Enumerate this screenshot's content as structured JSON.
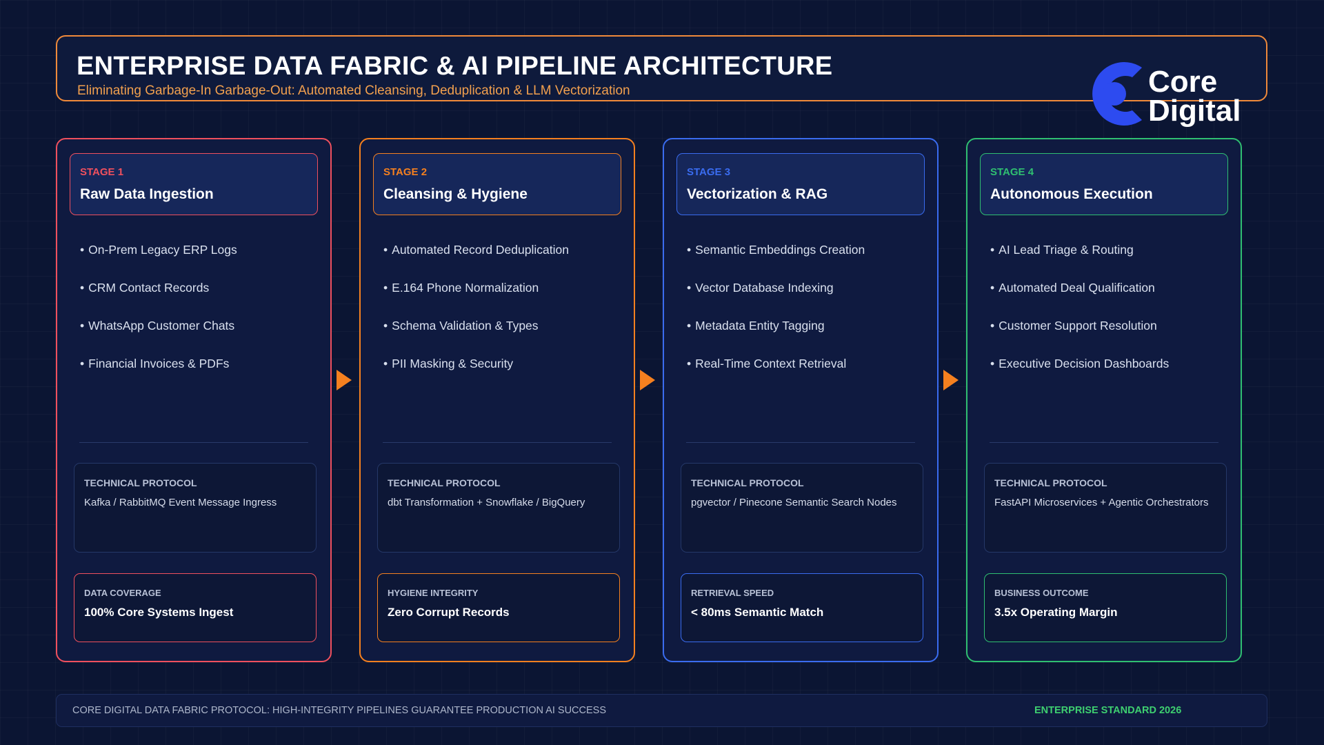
{
  "header": {
    "title": "ENTERPRISE DATA FABRIC & AI PIPELINE ARCHITECTURE",
    "subtitle": "Eliminating Garbage-In Garbage-Out: Automated Cleansing, Deduplication & LLM Vectorization"
  },
  "logo": {
    "word1": "Core",
    "word2": "Digital",
    "icon": "core-digital-logo-icon",
    "color": "#2d4bf0"
  },
  "colors": {
    "stage1": "#f0505e",
    "stage2": "#f5801f",
    "stage3": "#3a6cf0",
    "stage4": "#2fbf71",
    "arrow": "#f5801f"
  },
  "stages": [
    {
      "num": "STAGE 1",
      "title": "Raw Data Ingestion",
      "bullets": [
        "On-Prem Legacy ERP Logs",
        "CRM Contact Records",
        "WhatsApp Customer Chats",
        "Financial Invoices & PDFs"
      ],
      "protocol_label": "TECHNICAL PROTOCOL",
      "protocol": "Kafka / RabbitMQ Event Message Ingress",
      "metric_label": "DATA COVERAGE",
      "metric_value": "100% Core Systems Ingest"
    },
    {
      "num": "STAGE 2",
      "title": "Cleansing & Hygiene",
      "bullets": [
        "Automated Record Deduplication",
        "E.164 Phone Normalization",
        "Schema Validation & Types",
        "PII Masking & Security"
      ],
      "protocol_label": "TECHNICAL PROTOCOL",
      "protocol": "dbt Transformation + Snowflake / BigQuery",
      "metric_label": "HYGIENE INTEGRITY",
      "metric_value": "Zero Corrupt Records"
    },
    {
      "num": "STAGE 3",
      "title": "Vectorization & RAG",
      "bullets": [
        "Semantic Embeddings Creation",
        "Vector Database Indexing",
        "Metadata Entity Tagging",
        "Real-Time Context Retrieval"
      ],
      "protocol_label": "TECHNICAL PROTOCOL",
      "protocol": "pgvector / Pinecone Semantic Search Nodes",
      "metric_label": "RETRIEVAL SPEED",
      "metric_value": "< 80ms Semantic Match"
    },
    {
      "num": "STAGE 4",
      "title": "Autonomous Execution",
      "bullets": [
        "AI Lead Triage & Routing",
        "Automated Deal Qualification",
        "Customer Support Resolution",
        "Executive Decision Dashboards"
      ],
      "protocol_label": "TECHNICAL PROTOCOL",
      "protocol": "FastAPI Microservices + Agentic Orchestrators",
      "metric_label": "BUSINESS OUTCOME",
      "metric_value": "3.5x Operating Margin"
    }
  ],
  "footer": {
    "left": "CORE DIGITAL DATA FABRIC PROTOCOL: HIGH-INTEGRITY PIPELINES GUARANTEE PRODUCTION AI SUCCESS",
    "right": "ENTERPRISE STANDARD 2026"
  }
}
